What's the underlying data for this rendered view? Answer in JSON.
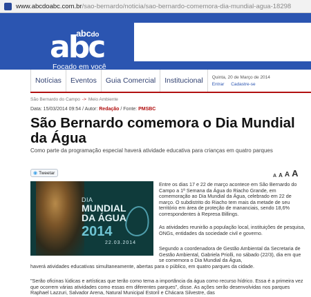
{
  "browser": {
    "url_host": "www.abcdoabc.com.br",
    "url_path": "/sao-bernardo/noticia/sao-bernardo-comemora-dia-mundial-agua-18298"
  },
  "header": {
    "logo_small": "abc",
    "logo_small_do": "do",
    "logo_big": "abc",
    "tagline": "Focado em você"
  },
  "nav": {
    "items": [
      "Notícias",
      "Eventos",
      "Guia Comercial",
      "Institucional"
    ],
    "date": "Quinta, 20 de Março de 2014",
    "login": "Entrar",
    "register": "Cadastre-se"
  },
  "breadcrumb": {
    "section": "São Bernardo do Campo",
    "separator": "->",
    "category": "Meio Ambiente"
  },
  "meta": {
    "date_label": "Data: 15/03/2014 09:54 / Autor:",
    "author": "Redação",
    "source_label": "/ Fonte:",
    "source": "PMSBC"
  },
  "article": {
    "title": "São Bernardo comemora o Dia Mundial da Água",
    "subtitle": "Como parte da programação especial haverá atividade educativa para crianças em quatro parques",
    "tweet_label": "Tweetar",
    "font_sizes": [
      "A",
      "A",
      "A",
      "A"
    ],
    "image": {
      "line1": "DIA",
      "line2": "MUNDIAL",
      "line3": "DA ÁGUA",
      "year": "2014",
      "date": "22.03.2014"
    },
    "p1": "Entre os dias 17 e 22 de março acontece em São Bernardo do Campo a 1ª Semana da Água do Riacho Grande, em comemoração ao Dia Mundial da Água, celebrado em 22 de março. O subdistrito do Riacho tem mais da metade de seu território em área de proteção de mananciais, sendo 18,6% correspondentes à Represa Billings.",
    "p2": "As atividades reunirão a população local, instituições de pesquisa, ONGs, entidades da sociedade civil e governo.",
    "p3": "Segundo a coordenadora de Gestão Ambiental da Secretaria de Gestão Ambiental, Gabriela Priolli, no sábado (22/3), dia em que se comemora o Dia Mundial da Água,",
    "p3b": "haverá atividades educativas simultaneamente, abertas para o público, em quatro parques da cidade.",
    "p4": "\"Serão oficinas lúdicas e artísticas que terão como tema a importância da água como recurso hídrico. Essa é a primeira vez que ocorrem várias atividades como essas em diferentes parques\", disse. As ações serão desenvolvidas nos parques Raphael Lazzuri, Salvador Arena, Natural Municipal Estoril e Chácara Silvestre, das"
  },
  "colors": {
    "header_blue": "#2b55b1",
    "accent_red": "#b10f0f",
    "nav_text": "#2f3f6f"
  }
}
